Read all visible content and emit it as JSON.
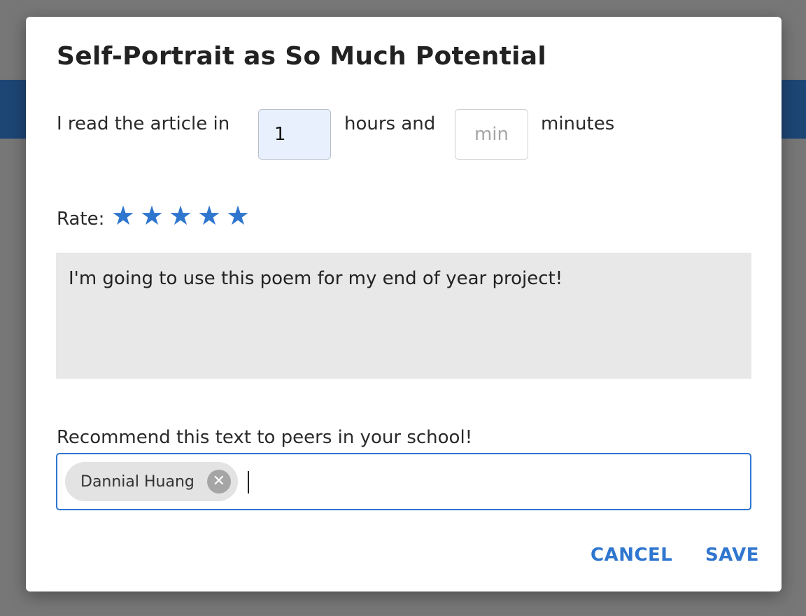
{
  "dialog": {
    "title": "Self-Portrait as So Much Potential",
    "reading_time": {
      "prefix": "I read the article in",
      "hours_value": "1",
      "hours_suffix": "hours and",
      "minutes_value": "",
      "minutes_placeholder": "min",
      "minutes_suffix": "minutes"
    },
    "rating": {
      "label": "Rate:",
      "value": 5,
      "max": 5,
      "star_glyph": "★",
      "star_color": "#2f76cf"
    },
    "comment": {
      "value": "I'm going to use this poem for my end of year project!"
    },
    "recommend": {
      "label": "Recommend this text to peers in your school!",
      "chips": [
        {
          "label": "Dannial Huang",
          "remove_icon": "close-circle-icon"
        }
      ]
    },
    "actions": {
      "cancel_label": "CANCEL",
      "save_label": "SAVE"
    }
  },
  "colors": {
    "accent": "#2f76cf",
    "backdrop": "#777777",
    "header_band": "#1d4675"
  }
}
